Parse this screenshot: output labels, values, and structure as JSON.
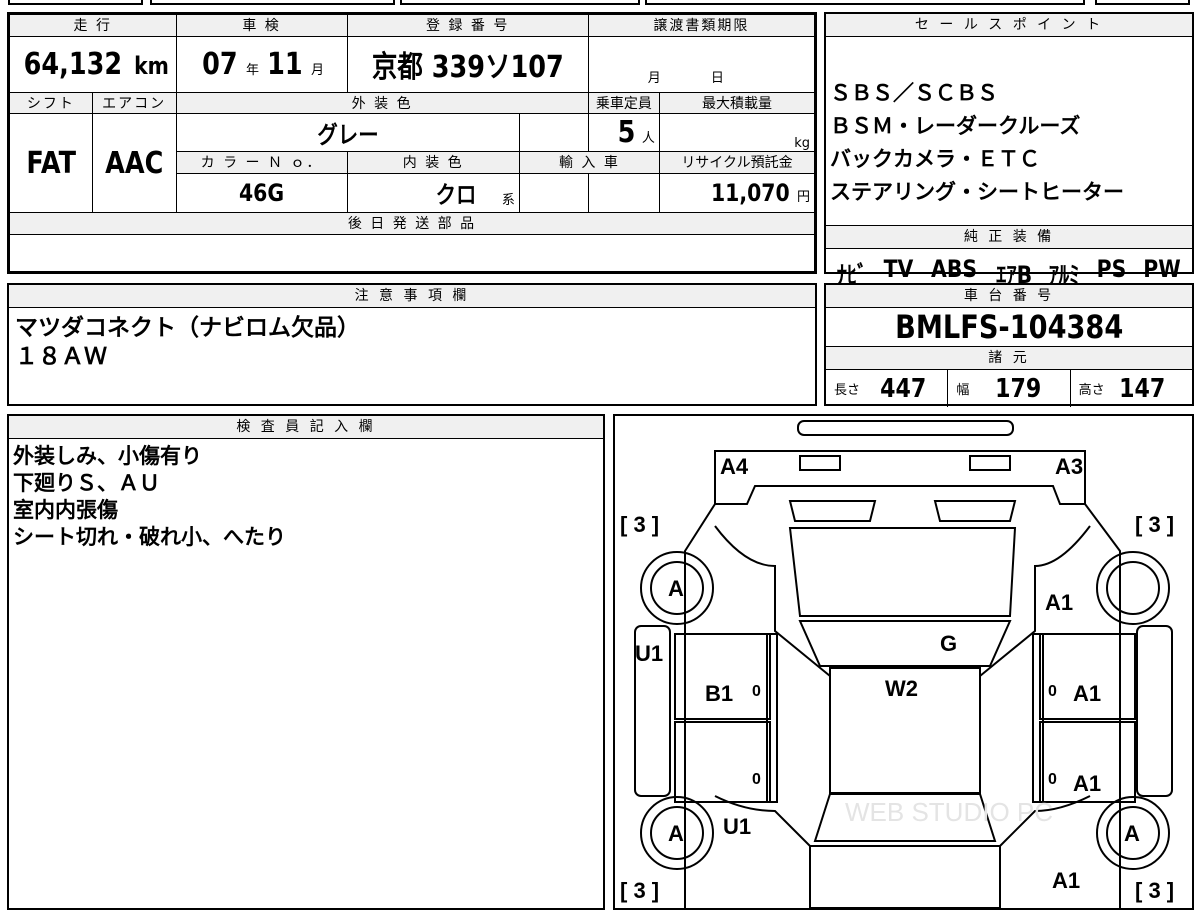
{
  "main_table": {
    "headers": {
      "mileage": "走 行",
      "inspection": "車 検",
      "reg_no": "登 録 番 号",
      "transfer_deadline": "譲渡書類期限",
      "shift": "シフト",
      "aircon": "エアコン",
      "ext_color": "外 装 色",
      "capacity": "乗車定員",
      "max_load": "最大積載量",
      "color_no": "カ ラ ー Ｎ ｏ．",
      "int_color": "内 装 色",
      "import": "輸 入 車",
      "recycle": "リサイクル預託金",
      "later_parts": "後 日 発 送 部 品"
    },
    "mileage_value": "64,132",
    "mileage_unit": "km",
    "inspection_year": "07",
    "year_unit": "年",
    "inspection_month": "11",
    "month_unit": "月",
    "reg_no": "京都 339ソ107",
    "deadline_month": "月",
    "deadline_day": "日",
    "shift": "FAT",
    "aircon": "AAC",
    "ext_color": "グレー",
    "capacity": "5",
    "capacity_unit": "人",
    "load_unit": "kg",
    "color_no": "46G",
    "int_color": "クロ",
    "int_color_suffix": "系",
    "recycle_value": "11,070",
    "recycle_unit": "円"
  },
  "sales_points": {
    "header": "セ ー ル ス ポ イ ン ト",
    "lines": [
      "ＳＢＳ／ＳＣＢＳ",
      "ＢＳＭ・レーダークルーズ",
      "バックカメラ・ＥＴＣ",
      "ステアリング・シートヒーター"
    ],
    "equip_header": "純 正 装 備",
    "equipment": [
      "ﾅﾋﾞ",
      "TV",
      "ABS",
      "ｴｱB",
      "ｱﾙﾐ",
      "PS",
      "PW"
    ]
  },
  "notes": {
    "header": "注 意 事 項 欄",
    "lines": [
      "マツダコネクト（ナビロム欠品）",
      "１８ＡＷ"
    ]
  },
  "chassis": {
    "header": "車 台 番 号",
    "number": "BMLFS-104384",
    "specs_header": "諸 元",
    "length_label": "長さ",
    "length": "447",
    "width_label": "幅",
    "width": "179",
    "height_label": "高さ",
    "height": "147"
  },
  "inspector": {
    "header": "検 査 員 記 入 欄",
    "lines": [
      "外装しみ、小傷有り",
      "下廻りＳ、ＡＵ",
      "室内内張傷",
      "シート切れ・破れ小、へたり"
    ]
  },
  "diagram": {
    "tire_labels": [
      "A",
      "A",
      "A"
    ],
    "tread_labels": [
      "[ 3 ]",
      "[ 3 ]",
      "[ 3 ]",
      "[ 3 ]"
    ],
    "marks": {
      "front_left": "A4",
      "front_right": "A3",
      "right_front": "A1",
      "right_door1": "A1",
      "right_door2": "A1",
      "right_rear": "A1",
      "left_sill": "U1",
      "left_door": "B1",
      "left_rear": "U1",
      "windshield": "G",
      "roof": "W2"
    },
    "zero": "0",
    "watermark": "WEB STUDIO PC"
  }
}
